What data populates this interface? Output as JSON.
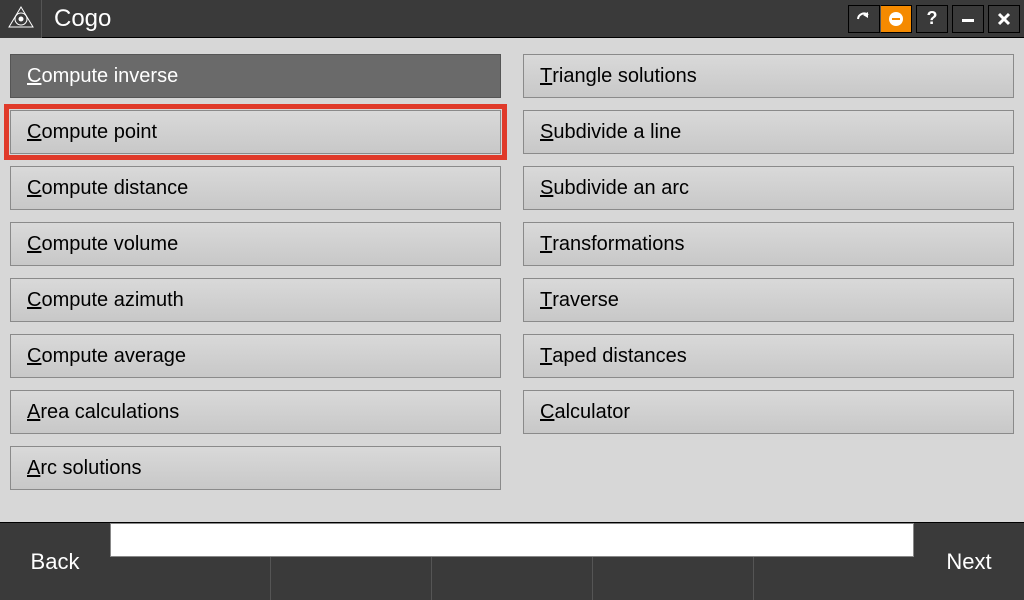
{
  "titlebar": {
    "title": "Cogo"
  },
  "menu": {
    "left": [
      {
        "accel": "C",
        "rest": "ompute inverse",
        "selected": true,
        "highlighted": false
      },
      {
        "accel": "C",
        "rest": "ompute point",
        "selected": false,
        "highlighted": true
      },
      {
        "accel": "C",
        "rest": "ompute distance",
        "selected": false,
        "highlighted": false
      },
      {
        "accel": "C",
        "rest": "ompute volume",
        "selected": false,
        "highlighted": false
      },
      {
        "accel": "C",
        "rest": "ompute azimuth",
        "selected": false,
        "highlighted": false
      },
      {
        "accel": "C",
        "rest": "ompute average",
        "selected": false,
        "highlighted": false
      },
      {
        "accel": "A",
        "rest": "rea calculations",
        "selected": false,
        "highlighted": false
      },
      {
        "accel": "A",
        "rest": "rc solutions",
        "selected": false,
        "highlighted": false
      }
    ],
    "right": [
      {
        "accel": "T",
        "rest": "riangle solutions",
        "selected": false,
        "highlighted": false
      },
      {
        "accel": "S",
        "rest": "ubdivide a line",
        "selected": false,
        "highlighted": false
      },
      {
        "accel": "S",
        "rest": "ubdivide an arc",
        "selected": false,
        "highlighted": false
      },
      {
        "accel": "T",
        "rest": "ransformations",
        "selected": false,
        "highlighted": false
      },
      {
        "accel": "T",
        "rest": "raverse",
        "selected": false,
        "highlighted": false
      },
      {
        "accel": "T",
        "rest": "aped distances",
        "selected": false,
        "highlighted": false
      },
      {
        "accel": "C",
        "rest": "alculator",
        "selected": false,
        "highlighted": false
      }
    ]
  },
  "bottombar": {
    "back_label": "Back",
    "next_label": "Next",
    "status_text": ""
  }
}
